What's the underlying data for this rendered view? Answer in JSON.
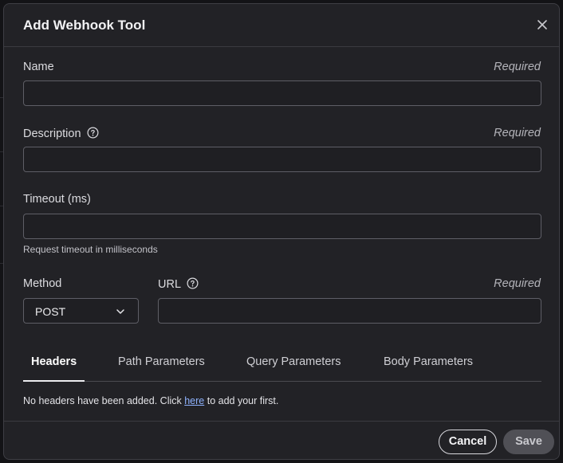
{
  "dialog": {
    "title": "Add Webhook Tool",
    "close_icon": "close-icon"
  },
  "fields": {
    "name": {
      "label": "Name",
      "required": "Required",
      "value": "",
      "placeholder": ""
    },
    "description": {
      "label": "Description",
      "required": "Required",
      "value": "",
      "placeholder": "",
      "help_icon": "help-circle-icon"
    },
    "timeout": {
      "label": "Timeout (ms)",
      "value": "",
      "placeholder": "",
      "hint": "Request timeout in milliseconds"
    },
    "method": {
      "label": "Method",
      "value": "POST",
      "chevron_icon": "chevron-down-icon"
    },
    "url": {
      "label": "URL",
      "required": "Required",
      "value": "",
      "placeholder": "",
      "help_icon": "help-circle-icon"
    }
  },
  "tabs": [
    {
      "label": "Headers",
      "active": true
    },
    {
      "label": "Path Parameters",
      "active": false
    },
    {
      "label": "Query Parameters",
      "active": false
    },
    {
      "label": "Body Parameters",
      "active": false
    }
  ],
  "headers_panel": {
    "empty_before": "No headers have been added. Click ",
    "link": "here",
    "empty_after": " to add your first."
  },
  "footer": {
    "cancel_label": "Cancel",
    "save_label": "Save"
  },
  "colors": {
    "background": "#222226",
    "border": "#3e3e44",
    "link": "#8fb3ff",
    "save_disabled": "#505056"
  }
}
